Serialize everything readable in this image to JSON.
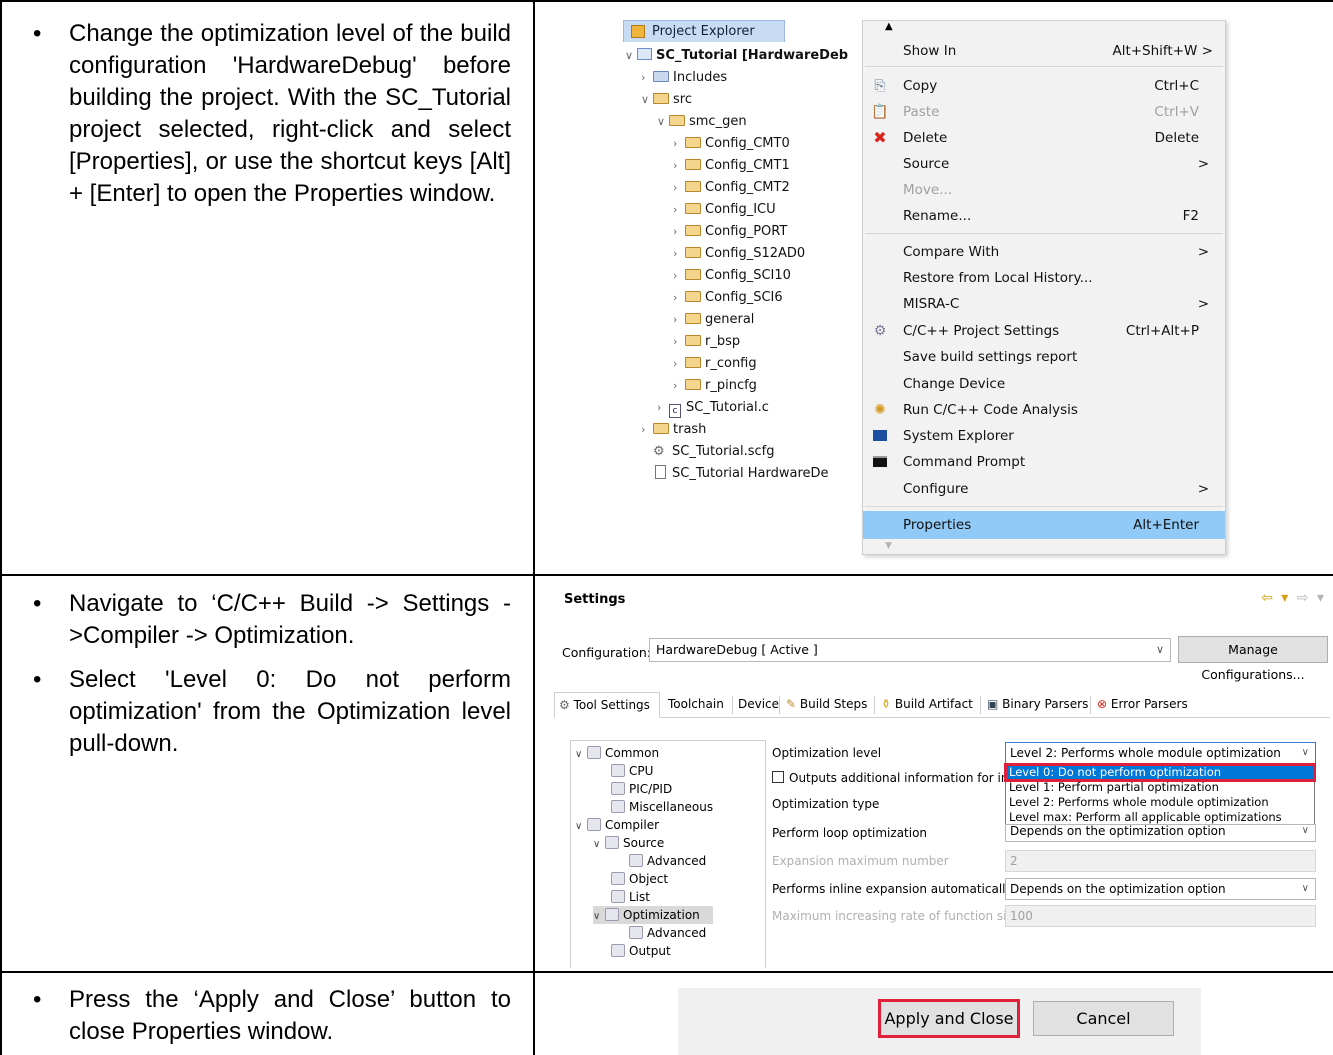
{
  "rows": [
    {
      "bullets": [
        "Change the optimization level of the build configuration 'HardwareDebug' before building the project. With the SC_Tutorial project selected, right-click and select [Properties], or use the shortcut keys [Alt] + [Enter] to open the Properties window."
      ]
    },
    {
      "bullets": [
        "Navigate to ‘C/C++ Build -> Settings ->Compiler -> Optimization.",
        "Select 'Level 0: Do not perform optimization' from the Optimization level pull-down."
      ]
    },
    {
      "bullets": [
        "Press the ‘Apply and Close’ button to close Properties window."
      ]
    }
  ],
  "bullet_glyph": "•",
  "explorer": {
    "tab_title": "Project Explorer",
    "items": [
      "SC_Tutorial [HardwareDeb",
      "Includes",
      "src",
      "smc_gen",
      "Config_CMT0",
      "Config_CMT1",
      "Config_CMT2",
      "Config_ICU",
      "Config_PORT",
      "Config_S12AD0",
      "Config_SCI10",
      "Config_SCI6",
      "general",
      "r_bsp",
      "r_config",
      "r_pincfg",
      "SC_Tutorial.c",
      "trash",
      "SC_Tutorial.scfg",
      "SC_Tutorial HardwareDe"
    ]
  },
  "context_menu": {
    "items": [
      {
        "label": "Show In",
        "key": "Alt+Shift+W >"
      },
      {
        "label": "Copy",
        "key": "Ctrl+C"
      },
      {
        "label": "Paste",
        "key": "Ctrl+V"
      },
      {
        "label": "Delete",
        "key": "Delete"
      },
      {
        "label": "Source",
        "key": ">"
      },
      {
        "label": "Move...",
        "key": ""
      },
      {
        "label": "Rename...",
        "key": "F2"
      },
      {
        "label": "Compare With",
        "key": ">"
      },
      {
        "label": "Restore from Local History...",
        "key": ""
      },
      {
        "label": "MISRA-C",
        "key": ">"
      },
      {
        "label": "C/C++ Project Settings",
        "key": "Ctrl+Alt+P"
      },
      {
        "label": "Save build settings report",
        "key": ""
      },
      {
        "label": "Change Device",
        "key": ""
      },
      {
        "label": "Run C/C++ Code Analysis",
        "key": ""
      },
      {
        "label": "System Explorer",
        "key": ""
      },
      {
        "label": "Command Prompt",
        "key": ""
      },
      {
        "label": "Configure",
        "key": ">"
      },
      {
        "label": "Properties",
        "key": "Alt+Enter"
      }
    ],
    "highlight_color": "#91c9f7"
  },
  "settings": {
    "title": "Settings",
    "config_label": "Configuration:",
    "config_value": "HardwareDebug  [ Active ]",
    "manage_button": "Manage Configurations...",
    "tabs": [
      "Tool Settings",
      "Toolchain",
      "Device",
      "Build Steps",
      "Build Artifact",
      "Binary Parsers",
      "Error Parsers"
    ],
    "tree": [
      "Common",
      "CPU",
      "PIC/PID",
      "Miscellaneous",
      "Compiler",
      "Source",
      "Advanced",
      "Object",
      "List",
      "Optimization",
      "Advanced",
      "Output"
    ],
    "options": {
      "optimization_level": "Optimization level",
      "outputs_info": "Outputs additional information for inte",
      "optimization_type": "Optimization type",
      "loop_opt": "Perform loop optimization",
      "expansion_max": "Expansion maximum number",
      "inline_auto": "Performs inline expansion automatically",
      "max_rate": "Maximum increasing rate of function size"
    },
    "values": {
      "level_selected": "Level 2: Performs whole module optimization",
      "loop_value": "Depends on the optimization option",
      "expansion_value": "2",
      "inline_value": "Depends on the optimization option",
      "rate_value": "100"
    },
    "dropdown_options": [
      "Level 0: Do not perform optimization",
      "Level 1: Perform partial optimization",
      "Level 2: Performs whole module optimization",
      "Level max: Perform all applicable optimizations"
    ]
  },
  "buttons": {
    "apply_close": "Apply and Close",
    "cancel": "Cancel"
  },
  "colors": {
    "highlight_border": "#e0203a",
    "selection": "#0078d7"
  }
}
